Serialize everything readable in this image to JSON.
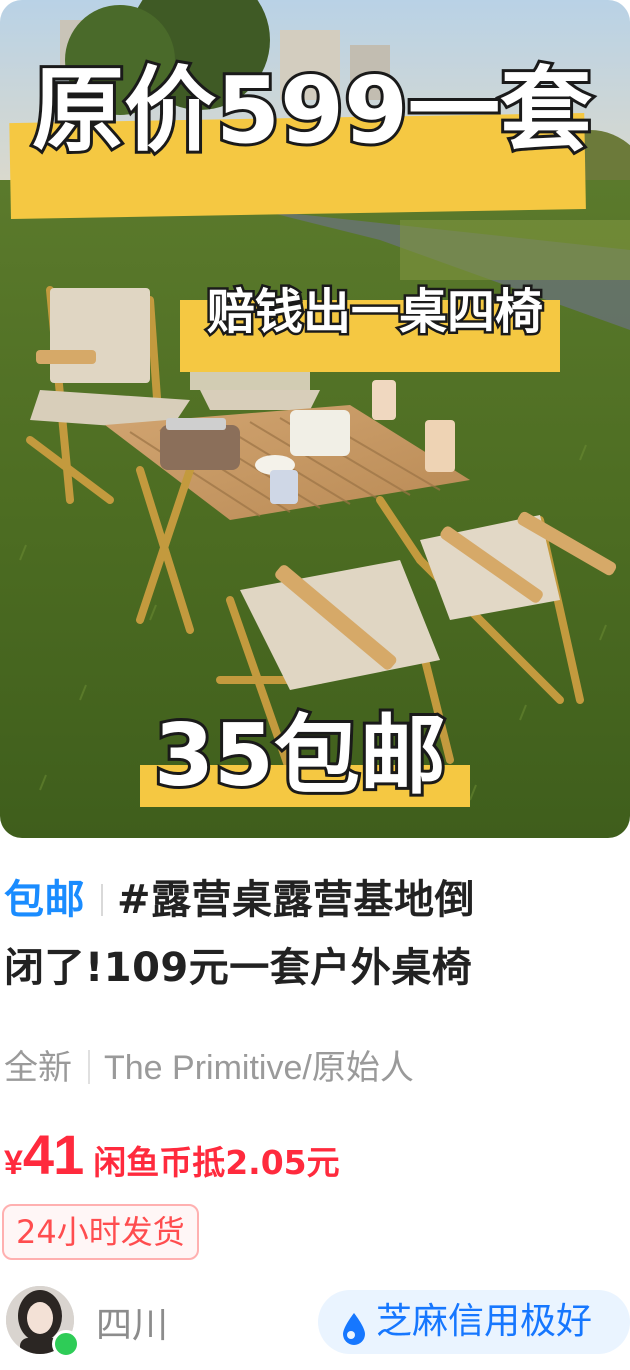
{
  "image": {
    "headline": "原价599一套",
    "sub": "赔钱出一桌四椅",
    "bottom": "35包邮",
    "banner_color": "#f5c842"
  },
  "title": {
    "tag": "包邮",
    "text_line1": "#露营桌露营基地倒",
    "text_line2": "闭了!109元一套户外桌椅"
  },
  "attributes": {
    "condition": "全新",
    "brand": "The Primitive/原始人"
  },
  "price": {
    "currency": "¥",
    "amount": "41",
    "coin_discount": "闲鱼币抵2.05元",
    "accent": "#ff2a3d"
  },
  "badge": "24小时发货",
  "seller": {
    "location": "四川",
    "credit": "芝麻信用极好"
  }
}
